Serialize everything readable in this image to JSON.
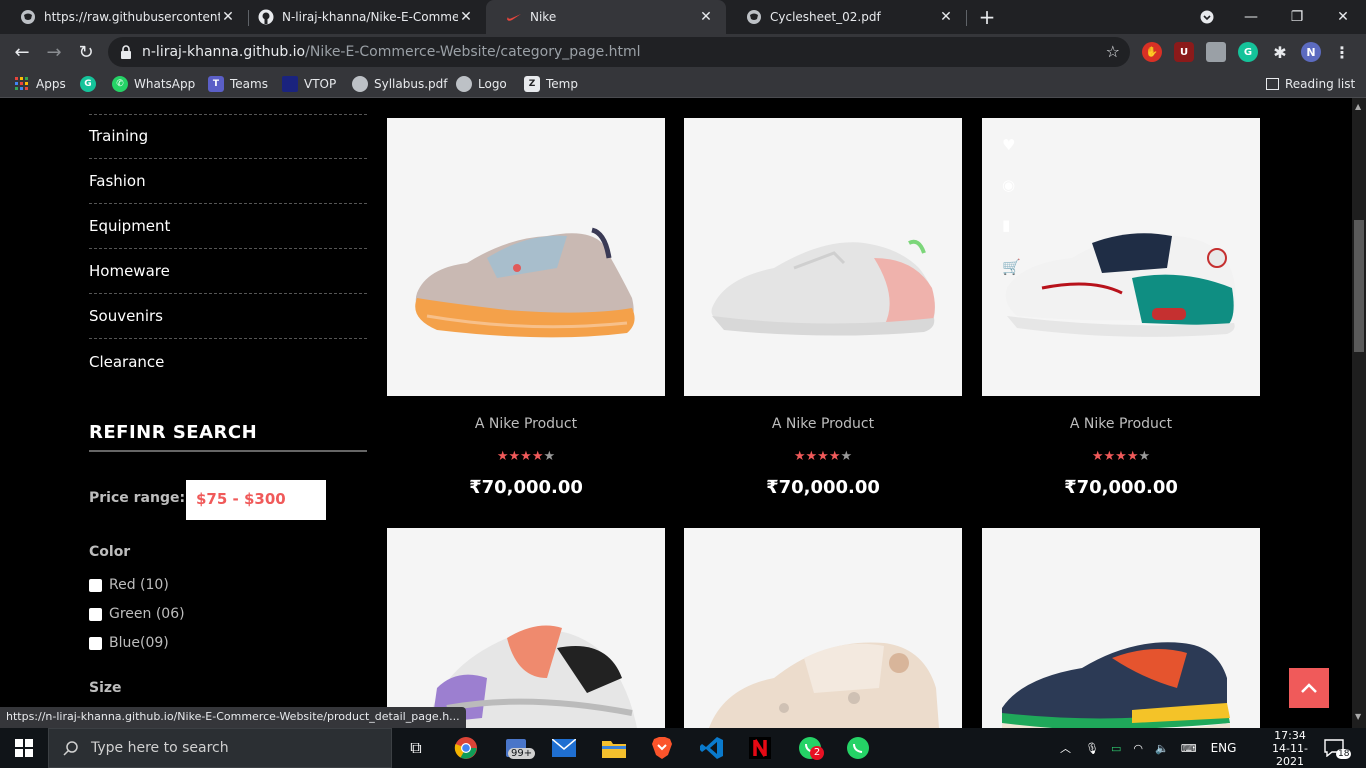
{
  "browser": {
    "tabs": [
      {
        "title": "https://raw.githubusercontent.co",
        "icon": "globe-icon",
        "active": false
      },
      {
        "title": "N-liraj-khanna/Nike-E-Commerce",
        "icon": "github-icon",
        "active": false
      },
      {
        "title": "Nike",
        "icon": "nike-swoosh-icon",
        "active": true
      },
      {
        "title": "Cyclesheet_02.pdf",
        "icon": "globe-icon",
        "active": false
      }
    ],
    "new_tab": "+",
    "url_host": "n-liraj-khanna.github.io",
    "url_path": "/Nike-E-Commerce-Website/category_page.html",
    "profile_initial": "N",
    "bookmarks": [
      "Apps",
      "WhatsApp",
      "Teams",
      "VTOP",
      "Syllabus.pdf",
      "Logo",
      "Temp"
    ],
    "reading_list": "Reading list",
    "status_url": "https://n-liraj-khanna.github.io/Nike-E-Commerce-Website/product_detail_page.h..."
  },
  "sidebar": {
    "categories": [
      "Training",
      "Fashion",
      "Equipment",
      "Homeware",
      "Souvenirs",
      "Clearance"
    ],
    "refine_title": "REFINR SEARCH",
    "price_label": "Price range:",
    "price_value": "$75 - $300",
    "color_label": "Color",
    "colors": [
      "Red (10)",
      "Green (06)",
      "Blue(09)"
    ],
    "size_label": "Size"
  },
  "products": [
    {
      "title": "A Nike Product",
      "rating": 4,
      "rating_max": 5,
      "price": "₹70,000.00"
    },
    {
      "title": "A Nike Product",
      "rating": 4,
      "rating_max": 5,
      "price": "₹70,000.00"
    },
    {
      "title": "A Nike Product",
      "rating": 4,
      "rating_max": 5,
      "price": "₹70,000.00"
    }
  ],
  "colors": {
    "accent": "#f05a5a",
    "page_bg": "#000000",
    "card_bg": "#f5f5f5"
  },
  "taskbar": {
    "search_placeholder": "Type here to search",
    "mail_badge": "99+",
    "whatsapp_badge": "2",
    "language": "ENG",
    "time": "17:34",
    "date": "14-11-2021",
    "notification_count": "18"
  }
}
